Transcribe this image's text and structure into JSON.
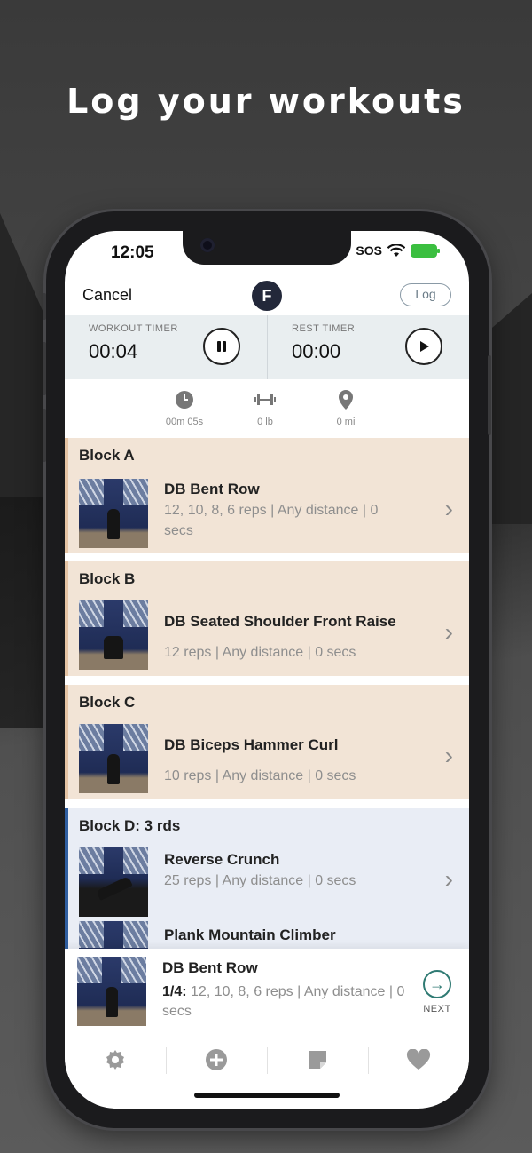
{
  "headline": "Log your workouts",
  "status": {
    "time": "12:05",
    "carrier": "SOS"
  },
  "nav": {
    "cancel": "Cancel",
    "logo_letter": "F",
    "log": "Log"
  },
  "timers": {
    "workout": {
      "label": "WORKOUT TIMER",
      "value": "00:04",
      "control": "pause-icon"
    },
    "rest": {
      "label": "REST TIMER",
      "value": "00:00",
      "control": "play-icon"
    }
  },
  "stats": [
    {
      "icon": "clock-icon",
      "value": "00m 05s"
    },
    {
      "icon": "dumbbell-icon",
      "value": "0 lb"
    },
    {
      "icon": "location-pin-icon",
      "value": "0 mi"
    }
  ],
  "blocks": [
    {
      "title": "Block A",
      "exercises": [
        {
          "name": "DB Bent Row",
          "detail": "12, 10, 8, 6 reps | Any distance | 0 secs"
        }
      ]
    },
    {
      "title": "Block B",
      "exercises": [
        {
          "name": "DB Seated Shoulder Front Raise",
          "detail": "12 reps | Any distance | 0 secs"
        }
      ]
    },
    {
      "title": "Block C",
      "exercises": [
        {
          "name": "DB Biceps Hammer Curl",
          "detail": "10 reps | Any distance | 0 secs"
        }
      ]
    },
    {
      "title": "Block D: 3 rds",
      "exercises": [
        {
          "name": "Reverse Crunch",
          "detail": "25 reps | Any distance | 0 secs"
        },
        {
          "name": "Plank Mountain Climber",
          "detail": ""
        }
      ]
    }
  ],
  "current": {
    "name": "DB Bent Row",
    "set": "1/4:",
    "detail": "12, 10, 8, 6 reps | Any distance | 0 secs",
    "next": "NEXT"
  },
  "tabbar": [
    {
      "icon": "gear-icon"
    },
    {
      "icon": "plus-circle-icon"
    },
    {
      "icon": "note-icon"
    },
    {
      "icon": "heart-icon"
    }
  ],
  "colors": {
    "block_bg": "#f2e4d6",
    "block_accent": "#e5c4a4",
    "superset_bg": "#e9edf5",
    "superset_accent": "#2f5ea0",
    "next_accent": "#2f7a73"
  }
}
